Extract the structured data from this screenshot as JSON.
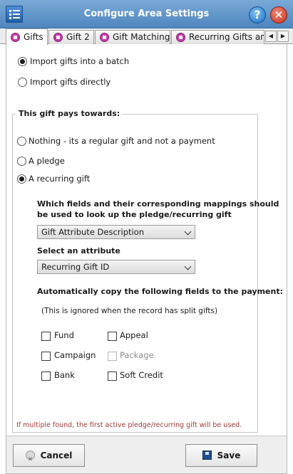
{
  "window": {
    "title": "Configure Area Settings",
    "help_glyph": "?",
    "close_glyph": "✕",
    "colors": {
      "titlebar": "#5b8fc8",
      "accent_icon": "#c43aa8",
      "note_text": "#a43a3a"
    }
  },
  "tabs": [
    {
      "label": "Gifts",
      "active": true
    },
    {
      "label": "Gift 2",
      "active": false
    },
    {
      "label": "Gift Matching",
      "active": false
    },
    {
      "label": "Recurring Gifts an",
      "active": false
    }
  ],
  "tab_scroll": {
    "left": "◀",
    "right": "▶"
  },
  "import_options": {
    "into_batch": {
      "label": "Import gifts into a batch",
      "selected": true
    },
    "directly": {
      "label": "Import gifts directly",
      "selected": false
    }
  },
  "pays_towards": {
    "title": "This gift pays towards:",
    "nothing": {
      "label": "Nothing - its a regular gift and not a payment",
      "selected": false
    },
    "pledge": {
      "label": "A pledge",
      "selected": false
    },
    "recurring": {
      "label": "A recurring gift",
      "selected": true
    }
  },
  "lookup": {
    "question_line1": "Which fields and their corresponding mappings should",
    "question_line2": "be used to look up the  pledge/recurring gift",
    "field_value": "Gift Attribute Description",
    "attribute_label": "Select an attribute",
    "attribute_value": "Recurring Gift ID"
  },
  "copy_fields": {
    "title": "Automatically copy the following fields to the payment:",
    "hint": "(This is ignored when the record has split gifts)",
    "items": [
      {
        "label": "Fund",
        "checked": false,
        "enabled": true
      },
      {
        "label": "Appeal",
        "checked": false,
        "enabled": true
      },
      {
        "label": "Campaign",
        "checked": false,
        "enabled": true
      },
      {
        "label": "Package",
        "checked": false,
        "enabled": false
      },
      {
        "label": "Bank",
        "checked": false,
        "enabled": true
      },
      {
        "label": "Soft Credit",
        "checked": false,
        "enabled": true
      }
    ]
  },
  "note": "If multiple found, the first active pledge/recurring gift will be used.",
  "footer": {
    "cancel_label": "Cancel",
    "save_label": "Save"
  }
}
